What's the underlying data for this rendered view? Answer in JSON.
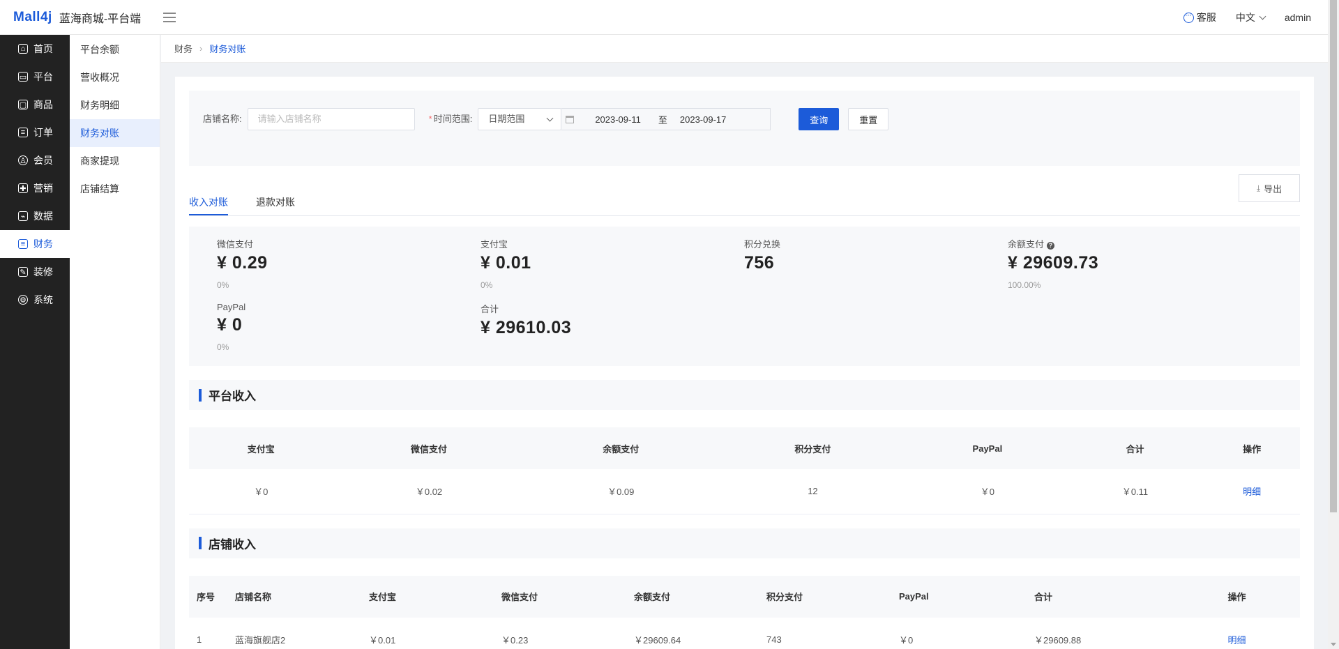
{
  "header": {
    "brand_main": "Mall4j",
    "site_name": "蓝海商城-平台端",
    "service": "客服",
    "language": "中文",
    "user": "admin"
  },
  "sidebar": {
    "items": [
      {
        "label": "首页",
        "icon": "home-icon",
        "glyph": "⌂"
      },
      {
        "label": "平台",
        "icon": "monitor-icon",
        "glyph": "▭"
      },
      {
        "label": "商品",
        "icon": "goods-icon",
        "glyph": "▢"
      },
      {
        "label": "订单",
        "icon": "order-icon",
        "glyph": "≡"
      },
      {
        "label": "会员",
        "icon": "member-icon",
        "glyph": "♙"
      },
      {
        "label": "营销",
        "icon": "gift-icon",
        "glyph": "✚"
      },
      {
        "label": "数据",
        "icon": "chart-icon",
        "glyph": "⌁"
      },
      {
        "label": "财务",
        "icon": "finance-icon",
        "glyph": "≡"
      },
      {
        "label": "装修",
        "icon": "decorate-icon",
        "glyph": "✎"
      },
      {
        "label": "系统",
        "icon": "settings-icon",
        "glyph": "⚙"
      }
    ],
    "active": "财务"
  },
  "submenu": {
    "items": [
      "平台余额",
      "营收概况",
      "财务明细",
      "财务对账",
      "商家提现",
      "店铺结算"
    ],
    "active": "财务对账"
  },
  "breadcrumb": {
    "parent": "财务",
    "current": "财务对账"
  },
  "filters": {
    "shop_label": "店铺名称:",
    "shop_placeholder": "请输入店铺名称",
    "time_label": "时间范围:",
    "range_type": "日期范围",
    "start_date": "2023-09-11",
    "to": "至",
    "end_date": "2023-09-17",
    "query": "查询",
    "reset": "重置"
  },
  "tabs": {
    "income": "收入对账",
    "refund": "退款对账",
    "export": "导出"
  },
  "stats": {
    "wechat": {
      "label": "微信支付",
      "value": "¥ 0.29",
      "pct": "0%"
    },
    "alipay": {
      "label": "支付宝",
      "value": "¥ 0.01",
      "pct": "0%"
    },
    "points": {
      "label": "积分兑换",
      "value": "756"
    },
    "balance": {
      "label": "余额支付",
      "value": "¥ 29609.73",
      "pct": "100.00%"
    },
    "paypal": {
      "label": "PayPal",
      "value": "¥ 0",
      "pct": "0%"
    },
    "total": {
      "label": "合计",
      "value": "¥ 29610.03"
    }
  },
  "platform": {
    "title": "平台收入",
    "headers": [
      "支付宝",
      "微信支付",
      "余额支付",
      "积分支付",
      "PayPal",
      "合计",
      "操作"
    ],
    "row": [
      "￥0",
      "￥0.02",
      "￥0.09",
      "12",
      "￥0",
      "￥0.11",
      "明细"
    ]
  },
  "shop": {
    "title": "店铺收入",
    "headers": [
      "序号",
      "店铺名称",
      "支付宝",
      "微信支付",
      "余额支付",
      "积分支付",
      "PayPal",
      "合计",
      "操作"
    ],
    "row": [
      "1",
      "蓝海旗舰店2",
      "￥0.01",
      "￥0.23",
      "￥29609.64",
      "743",
      "￥0",
      "￥29609.88",
      "明细"
    ]
  }
}
